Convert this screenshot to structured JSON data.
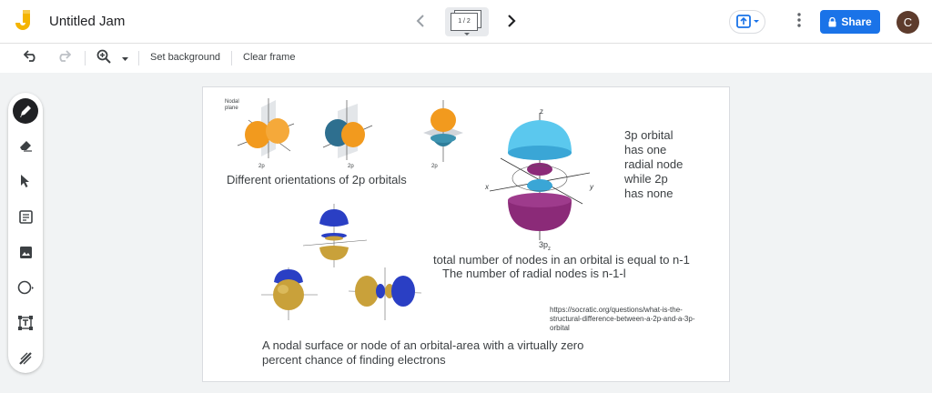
{
  "app": {
    "title": "Untitled Jam"
  },
  "frames": {
    "indicator": "1 / 2"
  },
  "header": {
    "share_label": "Share",
    "avatar_initial": "C"
  },
  "toolbar": {
    "set_background": "Set background",
    "clear_frame": "Clear frame"
  },
  "canvas": {
    "orient_caption": "Different orientations of 2p orbitals",
    "p_labels": [
      "2p",
      "2p",
      "2p"
    ],
    "nodal_plane_label": "Nodal plane",
    "p3_label": "3p",
    "p3_sub": "z",
    "p3_note_lines": [
      "3p orbital",
      "has one",
      "radial node",
      "while 2p",
      "has none"
    ],
    "nodes_line1": "total number of nodes in an orbital is equal to n-1",
    "nodes_line2": "The number of radial nodes is n-1-l",
    "source_url_lines": [
      "https://socratic.org/questions/what-is-the-",
      "structural-difference-between-a-2p-and-a-3p-",
      "orbital"
    ],
    "nodal_def_line1": "A nodal surface or node of an orbital-area with a virtually zero",
    "nodal_def_line2": "percent chance of finding electrons",
    "axis": {
      "x": "x",
      "y": "y",
      "z": "z"
    }
  },
  "colors": {
    "accent": "#1a73e8",
    "orbital_orange": "#f29a1e",
    "orbital_cyan": "#5bc8ee",
    "orbital_purple": "#8b2a78",
    "orbital_blue": "#2a3fc4",
    "orbital_gold": "#c9a13a"
  }
}
